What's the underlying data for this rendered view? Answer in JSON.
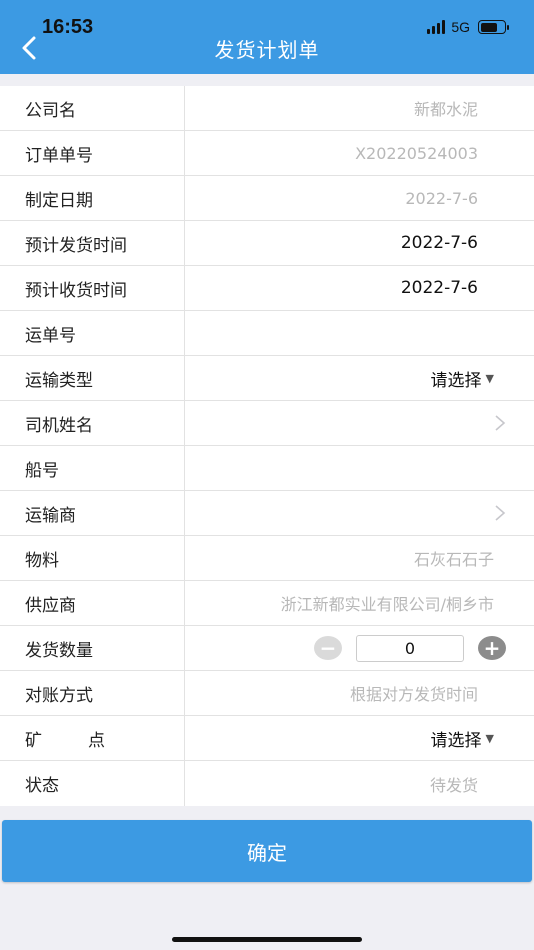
{
  "status_bar": {
    "time": "16:53",
    "network": "5G"
  },
  "header": {
    "title": "发货计划单"
  },
  "form": {
    "company": {
      "label": "公司名",
      "value": "新都水泥"
    },
    "order_no": {
      "label": "订单单号",
      "value": "X20220524003"
    },
    "create_date": {
      "label": "制定日期",
      "value": "2022-7-6"
    },
    "plan_ship_time": {
      "label": "预计发货时间",
      "value": "2022-7-6"
    },
    "plan_receive_time": {
      "label": "预计收货时间",
      "value": "2022-7-6"
    },
    "waybill_no": {
      "label": "运单号",
      "value": ""
    },
    "transport_type": {
      "label": "运输类型",
      "value": "请选择"
    },
    "driver_name": {
      "label": "司机姓名",
      "value": ""
    },
    "ship_no": {
      "label": "船号",
      "value": ""
    },
    "carrier": {
      "label": "运输商",
      "value": ""
    },
    "material": {
      "label": "物料",
      "value": "石灰石石子"
    },
    "supplier": {
      "label": "供应商",
      "value": "浙江新都实业有限公司/桐乡市"
    },
    "ship_qty": {
      "label": "发货数量",
      "value": "0"
    },
    "reconcile_method": {
      "label": "对账方式",
      "value": "根据对方发货时间"
    },
    "mine_point": {
      "label_part1": "矿",
      "label_part2": "点",
      "value": "请选择"
    },
    "status": {
      "label": "状态",
      "value": "待发货"
    }
  },
  "confirm_button": {
    "label": "确定"
  },
  "icons": {
    "back": "back-chevron-icon",
    "arrow": "chevron-right-icon",
    "caret": "caret-down-icon"
  },
  "colors": {
    "primary": "#3c9ae3",
    "placeholder": "#b8b8b8"
  }
}
